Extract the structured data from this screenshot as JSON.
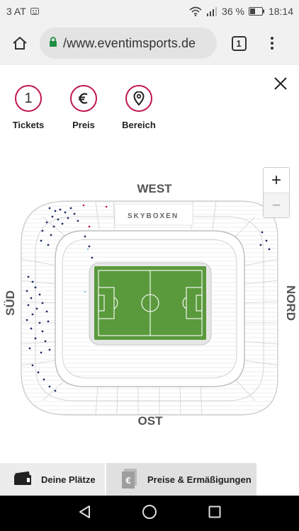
{
  "status_bar": {
    "carrier": "3 AT",
    "battery": "36 %",
    "time": "18:14"
  },
  "browser": {
    "url": "/www.eventimsports.de",
    "tab_count": "1",
    "icons": [
      "home-icon",
      "lock-icon",
      "tabs-icon",
      "menu-icon"
    ]
  },
  "filters": {
    "items": [
      {
        "label": "Tickets",
        "value": "1",
        "icon": "number"
      },
      {
        "label": "Preis",
        "value": "€",
        "icon": "euro-icon"
      },
      {
        "label": "Bereich",
        "value": "",
        "icon": "location-pin-icon"
      }
    ],
    "accent": "#c0174a"
  },
  "map": {
    "labels": {
      "west": "WEST",
      "ost": "OST",
      "sued": "SÜD",
      "nord": "NORD",
      "skyboxen": "SKYBOXEN"
    },
    "zoom_in": "+",
    "zoom_out": "−",
    "pitch_color": "#5a9a3c",
    "seat_color": "#1f2f66"
  },
  "bottom_tabs": {
    "places": "Deine Plätze",
    "prices": "Preise & Ermäßigungen"
  },
  "nav": {
    "icons": [
      "back-icon",
      "home-circle-icon",
      "recents-icon"
    ]
  }
}
